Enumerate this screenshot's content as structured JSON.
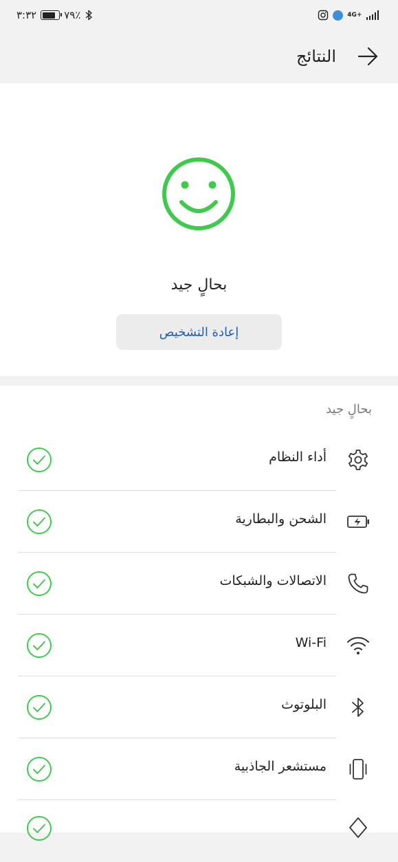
{
  "status_bar": {
    "time": "٣:٣٢",
    "battery_text": "٧٩٪",
    "battery_level": 0.79,
    "network_type": "4G",
    "network_sub": "+",
    "signal_bars": 4
  },
  "header": {
    "title": "النتائج"
  },
  "result": {
    "status": "بحالٍ جيد",
    "rediagnose_label": "إعادة التشخيص",
    "accent_color": "#3fca4d"
  },
  "checks": {
    "section_label": "بحالٍ جيد",
    "items": [
      {
        "label": "أداء النظام",
        "icon": "gear-icon",
        "status": "ok"
      },
      {
        "label": "الشحن والبطارية",
        "icon": "battery-charging-icon",
        "status": "ok"
      },
      {
        "label": "الاتصالات والشبكات",
        "icon": "phone-icon",
        "status": "ok"
      },
      {
        "label": "Wi-Fi",
        "icon": "wifi-icon",
        "status": "ok"
      },
      {
        "label": "البلوتوث",
        "icon": "bluetooth-icon",
        "status": "ok"
      },
      {
        "label": "مستشعر الجاذبية",
        "icon": "vibrate-phone-icon",
        "status": "ok"
      }
    ]
  }
}
